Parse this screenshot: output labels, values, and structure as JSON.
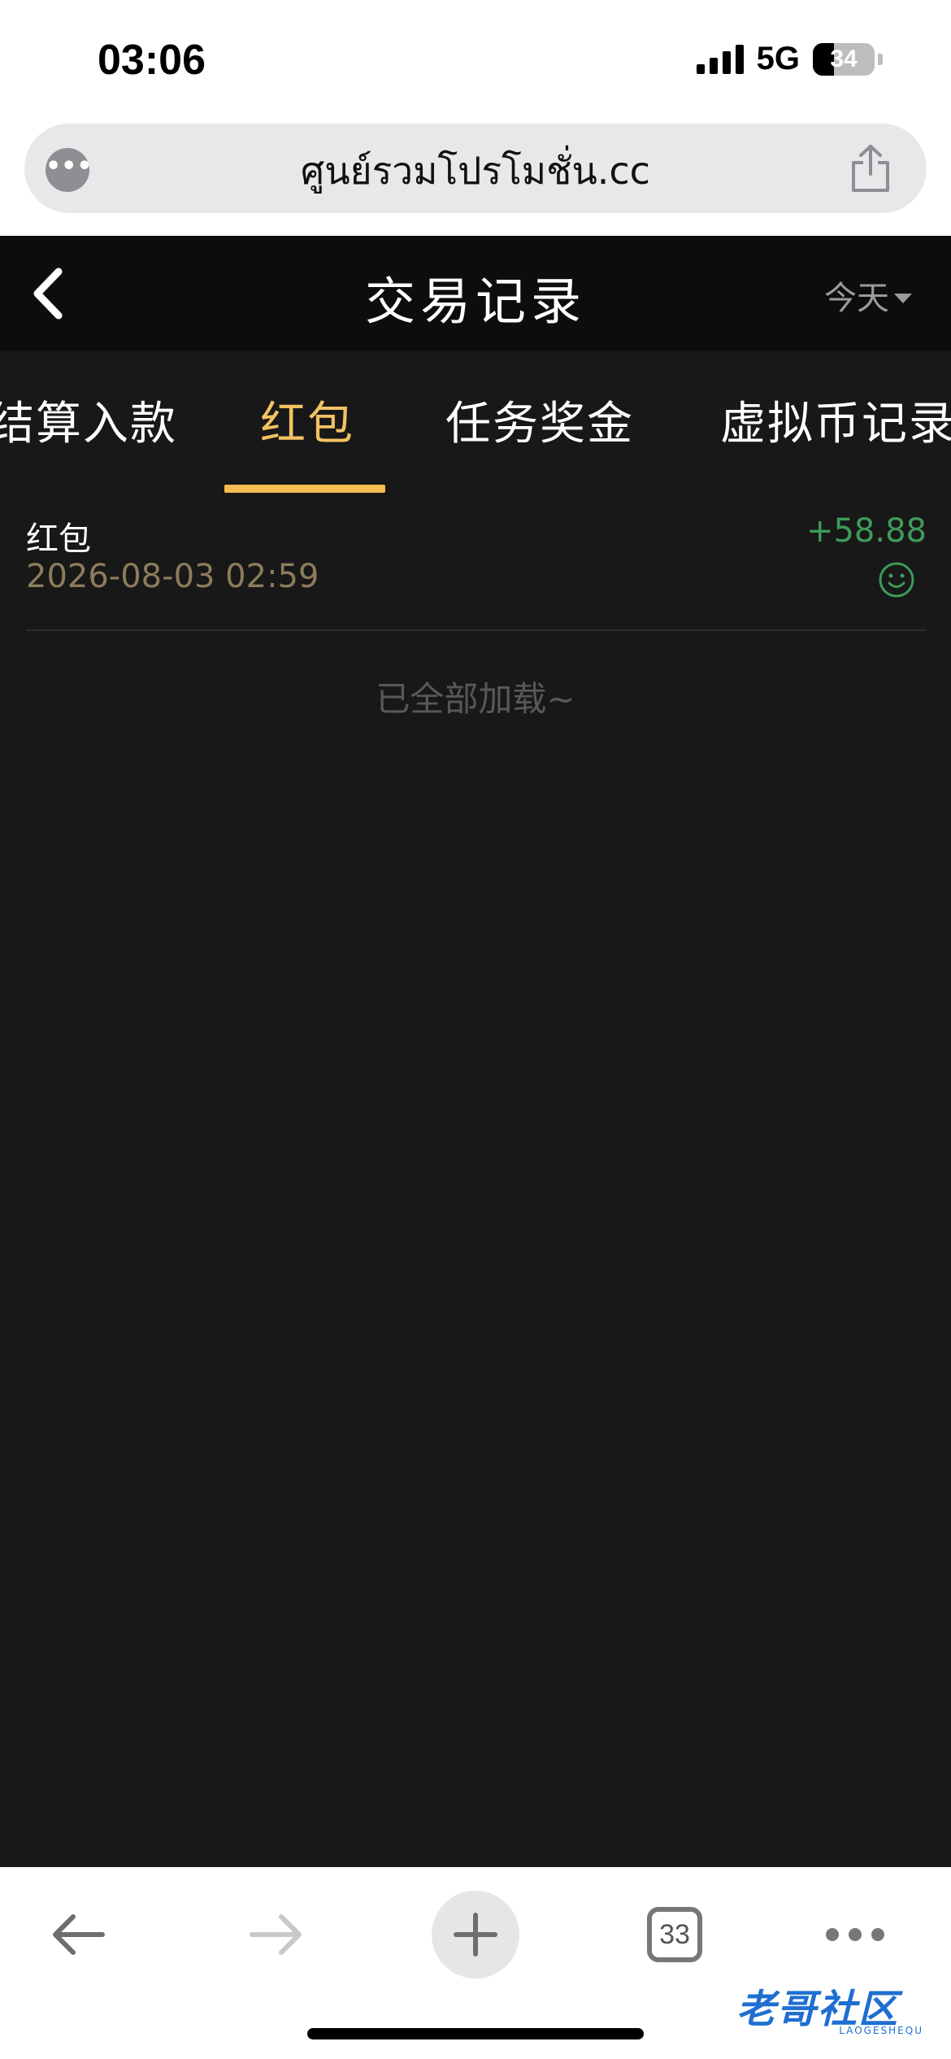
{
  "status_bar": {
    "time": "03:06",
    "network": "5G",
    "battery": "34"
  },
  "browser": {
    "url": "ศูนย์รวมโปรโมชั่น.cc",
    "tab_count": "33"
  },
  "header": {
    "title": "交易记录",
    "date_filter": "今天"
  },
  "tabs": [
    {
      "label": "结算入款",
      "active": false
    },
    {
      "label": "红包",
      "active": true
    },
    {
      "label": "任务奖金",
      "active": false
    },
    {
      "label": "虚拟币记录",
      "active": false
    }
  ],
  "records": [
    {
      "type": "红包",
      "time": "2026-08-03 02:59",
      "amount": "+58.88",
      "status_icon": "smile-icon"
    }
  ],
  "list_end_text": "已全部加载~",
  "watermark": {
    "text": "老哥社区",
    "sub": "LAOGESHEQU"
  },
  "colors": {
    "accent": "#f3c262",
    "positive": "#3e9b5b",
    "background": "#181818"
  }
}
